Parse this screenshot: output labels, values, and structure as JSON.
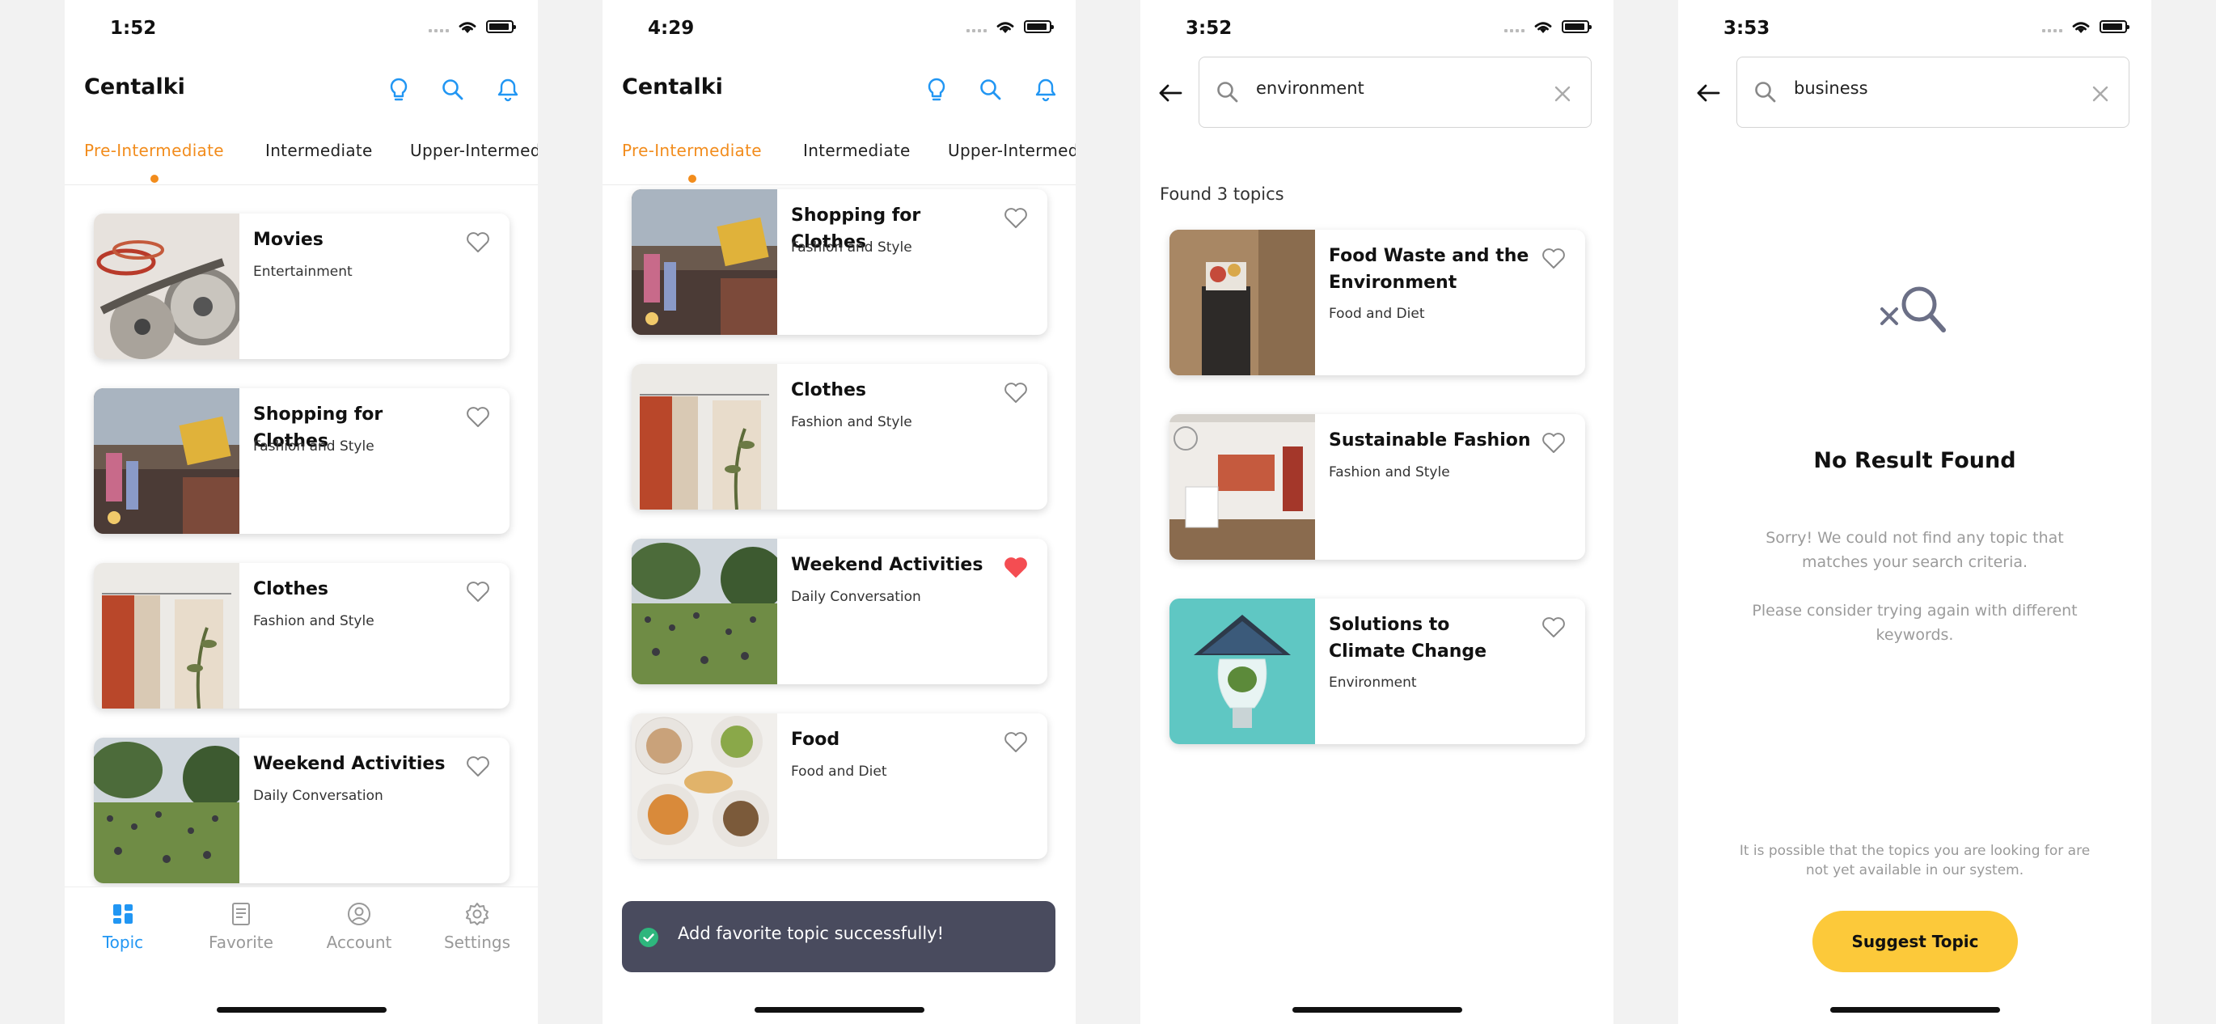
{
  "colors": {
    "accent_orange": "#f28c1c",
    "accent_blue": "#2196f3",
    "heart_red": "#f44d52",
    "toast_bg": "#494b5e",
    "suggest_yellow": "#fcc93a"
  },
  "screens": [
    {
      "time": "1:52",
      "app_title": "Centalki",
      "header_icons": [
        "lightbulb-icon",
        "search-icon",
        "bell-icon"
      ],
      "tabs": [
        "Pre-Intermediate",
        "Intermediate",
        "Upper-Intermediate"
      ],
      "active_tab": 0,
      "cards": [
        {
          "title": "Movies",
          "subtitle": "Entertainment",
          "favorited": false
        },
        {
          "title": "Shopping for Clothes",
          "subtitle": "Fashion and Style",
          "favorited": false
        },
        {
          "title": "Clothes",
          "subtitle": "Fashion and Style",
          "favorited": false
        },
        {
          "title": "Weekend Activities",
          "subtitle": "Daily Conversation",
          "favorited": false
        }
      ],
      "bottom_nav": [
        {
          "label": "Topic",
          "icon": "grid-icon",
          "active": true
        },
        {
          "label": "Favorite",
          "icon": "list-doc-icon",
          "active": false
        },
        {
          "label": "Account",
          "icon": "user-circle-icon",
          "active": false
        },
        {
          "label": "Settings",
          "icon": "gear-icon",
          "active": false
        }
      ]
    },
    {
      "time": "4:29",
      "app_title": "Centalki",
      "tabs": [
        "Pre-Intermediate",
        "Intermediate",
        "Upper-Intermediate"
      ],
      "active_tab": 0,
      "cards": [
        {
          "title": "Shopping for Clothes",
          "subtitle": "Fashion and Style",
          "favorited": false
        },
        {
          "title": "Clothes",
          "subtitle": "Fashion and Style",
          "favorited": false
        },
        {
          "title": "Weekend Activities",
          "subtitle": "Daily Conversation",
          "favorited": true
        },
        {
          "title": "Food",
          "subtitle": "Food and Diet",
          "favorited": false
        }
      ],
      "toast": "Add favorite topic successfully!"
    },
    {
      "time": "3:52",
      "search_query": "environment",
      "found_text": "Found 3 topics",
      "cards": [
        {
          "title": "Food Waste and the Environment",
          "subtitle": "Food and Diet",
          "favorited": false
        },
        {
          "title": "Sustainable Fashion",
          "subtitle": "Fashion and Style",
          "favorited": false
        },
        {
          "title": "Solutions to Climate Change",
          "subtitle": "Environment",
          "favorited": false
        }
      ]
    },
    {
      "time": "3:53",
      "search_query": "business",
      "no_result_title": "No Result Found",
      "no_result_text_1": "Sorry! We could not find any topic that matches your search criteria.",
      "no_result_text_2": "Please consider trying again with different keywords.",
      "footnote": "It is possible that the topics you are looking for are not yet available in our system.",
      "suggest_button": "Suggest Topic"
    }
  ]
}
